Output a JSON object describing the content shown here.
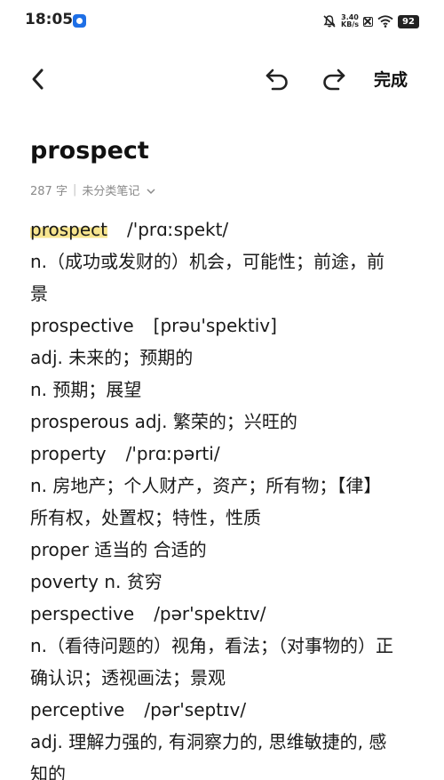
{
  "status_bar": {
    "time": "18:05",
    "speed_value": "3.40",
    "speed_unit": "KB/s",
    "battery": "92"
  },
  "toolbar": {
    "done_label": "完成",
    "icons": [
      "back-icon",
      "undo-icon",
      "redo-icon"
    ]
  },
  "note": {
    "title": "prospect",
    "word_count": "287 字",
    "category": "未分类笔记"
  },
  "content": {
    "l1_word": "prospect",
    "l1_phon": "/'prɑːspekt/",
    "l2": "n.（成功或发财的）机会，可能性；前途，前",
    "l3": "景",
    "l4_word": "prospective",
    "l4_phon": "[prəu'spektiv]",
    "l5": "adj. 未来的；预期的",
    "l6": "n. 预期；展望",
    "l7": "prosperous adj. 繁荣的；兴旺的",
    "l8_word": "property",
    "l8_phon": "/'prɑːpərti/",
    "l9": "n. 房地产；个人财产，资产；所有物；【律】",
    "l10": "所有权，处置权；特性，性质",
    "l11": "proper 适当的 合适的",
    "l12": "poverty n. 贫穷",
    "l13_word": "perspective",
    "l13_phon": "/pər'spektɪv/",
    "l14": "n.（看待问题的）视角，看法；（对事物的）正",
    "l15": "确认识；透视画法；景观",
    "l16_word": "perceptive",
    "l16_phon": "/pər'septɪv/",
    "l17": "adj. 理解力强的, 有洞察力的, 思维敏捷的, 感",
    "l18": "知的"
  },
  "colors": {
    "highlight": "#f7e58f",
    "meta_text": "#8a8a8a",
    "app_icon": "#1e6fe6"
  }
}
